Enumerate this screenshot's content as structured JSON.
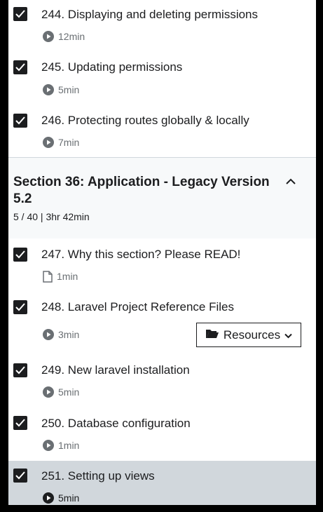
{
  "lectures_before": [
    {
      "title": "244. Displaying and deleting permissions",
      "duration": "12min",
      "icon": "play-icon",
      "checked": true
    },
    {
      "title": "245. Updating permissions",
      "duration": "5min",
      "icon": "play-icon",
      "checked": true
    },
    {
      "title": "246. Protecting routes globally & locally",
      "duration": "7min",
      "icon": "play-icon",
      "checked": true
    }
  ],
  "section": {
    "title": "Section 36: Application - Legacy Version 5.2",
    "subtitle": "5 / 40 | 3hr 42min",
    "toggle_icon": "chevron-up-icon"
  },
  "lectures": [
    {
      "title": "247. Why this section? Please READ!",
      "duration": "1min",
      "icon": "file-icon",
      "checked": true
    },
    {
      "title": "248. Laravel Project Reference Files",
      "duration": "3min",
      "icon": "play-icon",
      "checked": true,
      "resources_label": "Resources"
    },
    {
      "title": "249. New laravel installation",
      "duration": "5min",
      "icon": "play-icon",
      "checked": true
    },
    {
      "title": "250. Database configuration",
      "duration": "1min",
      "icon": "play-icon",
      "checked": true
    },
    {
      "title": "251. Setting up views",
      "duration": "5min",
      "icon": "play-icon",
      "checked": true,
      "active": true
    }
  ],
  "colors": {
    "background": "#000000",
    "panel": "#ffffff",
    "section_bg": "#f7f9fa",
    "active_row": "#d1d7dc",
    "text": "#1c1d1f",
    "muted": "#6a6f73"
  }
}
